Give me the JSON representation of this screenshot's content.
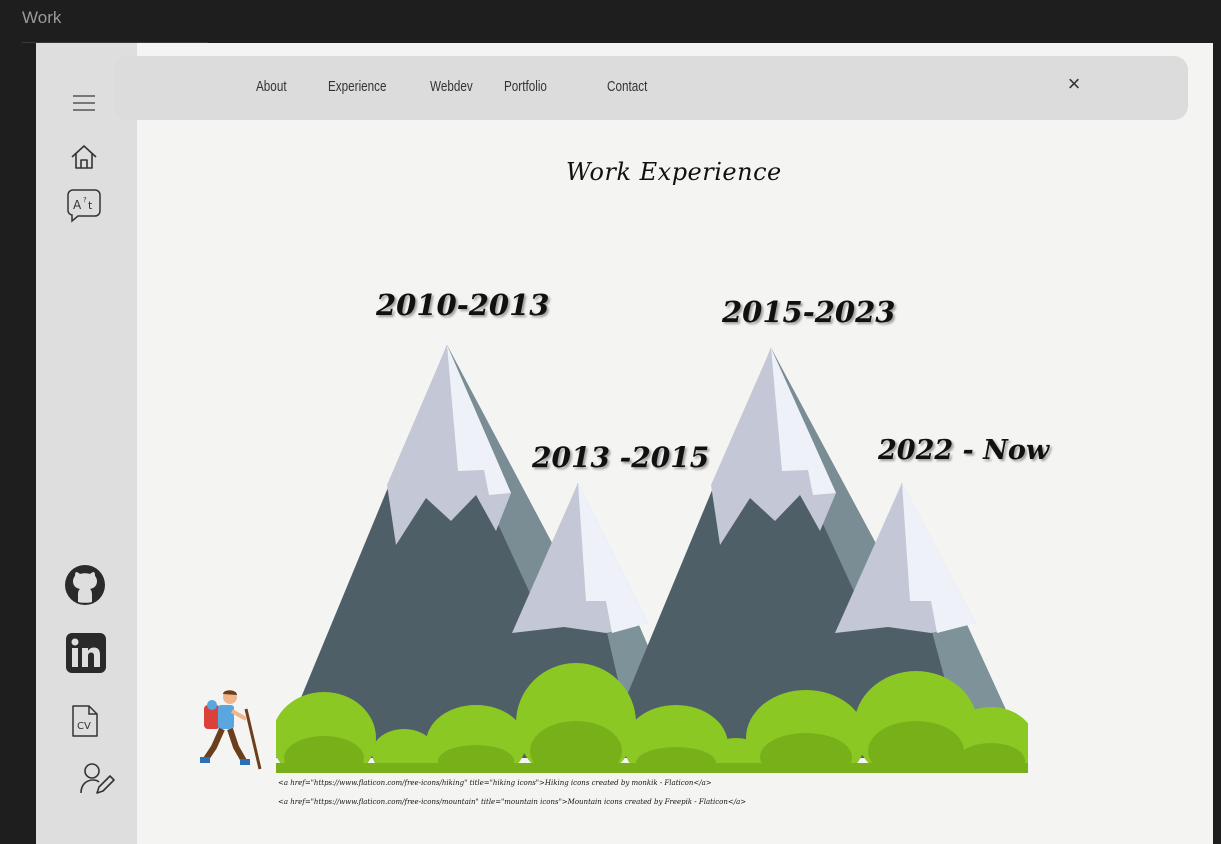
{
  "window": {
    "title": "Work"
  },
  "nav": {
    "items": [
      {
        "label": "About"
      },
      {
        "label": "Experience"
      },
      {
        "label": "Webdev"
      },
      {
        "label": "Portfolio"
      },
      {
        "label": "Contact"
      }
    ],
    "close_label": "×"
  },
  "sidebar": {
    "icons": [
      "menu-icon",
      "home-icon",
      "translate-icon",
      "github-icon",
      "linkedin-icon",
      "cv-icon",
      "user-edit-icon"
    ],
    "cv_label": "CV"
  },
  "main": {
    "title": "Work Experience",
    "periods": [
      {
        "label": "2010-2013"
      },
      {
        "label": "2013 -2015"
      },
      {
        "label": "2015-2023"
      },
      {
        "label": "2022 - Now"
      }
    ],
    "credits": [
      "<a href=\"https://www.flaticon.com/free-icons/hiking\" title=\"hiking icons\">Hiking icons created by monkik - Flaticon</a>",
      "<a href=\"https://www.flaticon.com/free-icons/mountain\" title=\"mountain icons\">Mountain icons created by Freepik - Flaticon</a>"
    ]
  },
  "colors": {
    "background": "#1e1e1e",
    "page": "#f4f4f2",
    "sidebar": "#dedede",
    "navbar": "#dcdcdc",
    "mountain_dark": "#4f5f68",
    "mountain_mid": "#7e9299",
    "snow_light": "#eef1f8",
    "snow_shadow": "#c3c7d6",
    "bush_light": "#8bc823",
    "bush_dark": "#78b01a"
  }
}
